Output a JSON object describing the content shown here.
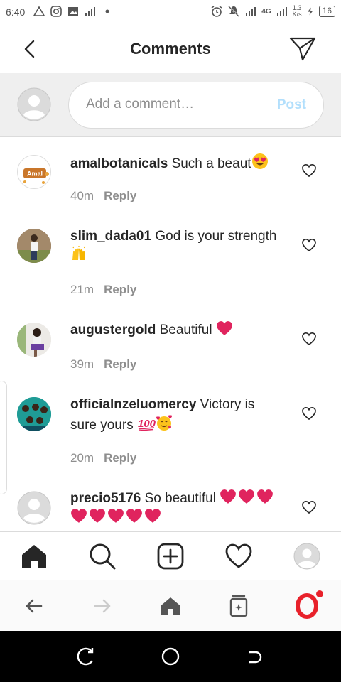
{
  "status_bar": {
    "time": "6:40",
    "network_speed_value": "1.3",
    "network_speed_unit": "K/s",
    "network_type": "4G",
    "battery": "16"
  },
  "header": {
    "title": "Comments"
  },
  "composer": {
    "placeholder": "Add a comment…",
    "post_label": "Post"
  },
  "comments": [
    {
      "username": "amalbotanicals",
      "text": "Such a beaut",
      "emojis": [
        "heart-eyes"
      ],
      "time": "40m",
      "reply_label": "Reply",
      "avatar_text": "Amal"
    },
    {
      "username": "slim_dada01",
      "text": "God is your strength",
      "emojis": [
        "raised-hands"
      ],
      "time": "21m",
      "reply_label": "Reply"
    },
    {
      "username": "augustergold",
      "text": "Beautiful",
      "emojis": [
        "red-heart"
      ],
      "time": "39m",
      "reply_label": "Reply"
    },
    {
      "username": "officialnzeluomercy",
      "text": "Victory is sure yours",
      "emojis": [
        "hundred-points",
        "smiling-face-with-hearts"
      ],
      "time": "20m",
      "reply_label": "Reply"
    },
    {
      "username": "precio5176",
      "text": "So beautiful",
      "emojis": [
        "red-heart",
        "red-heart",
        "red-heart",
        "red-heart",
        "red-heart",
        "red-heart",
        "red-heart",
        "red-heart"
      ]
    }
  ],
  "colors": {
    "accent_disabled": "#b2dffc",
    "text_primary": "#262626",
    "text_secondary": "#8e8e8e",
    "heart_red": "#e0245e",
    "opera_red": "#e8212b"
  },
  "icons": {
    "tab_bar": [
      "home-icon",
      "search-icon",
      "new-post-icon",
      "activity-heart-icon",
      "profile-avatar-icon"
    ],
    "browser_bar": [
      "back-arrow-icon",
      "forward-arrow-icon",
      "home-icon",
      "tabs-icon",
      "opera-logo-icon"
    ],
    "system_nav": [
      "recents-icon",
      "home-circle-icon",
      "back-icon"
    ]
  }
}
